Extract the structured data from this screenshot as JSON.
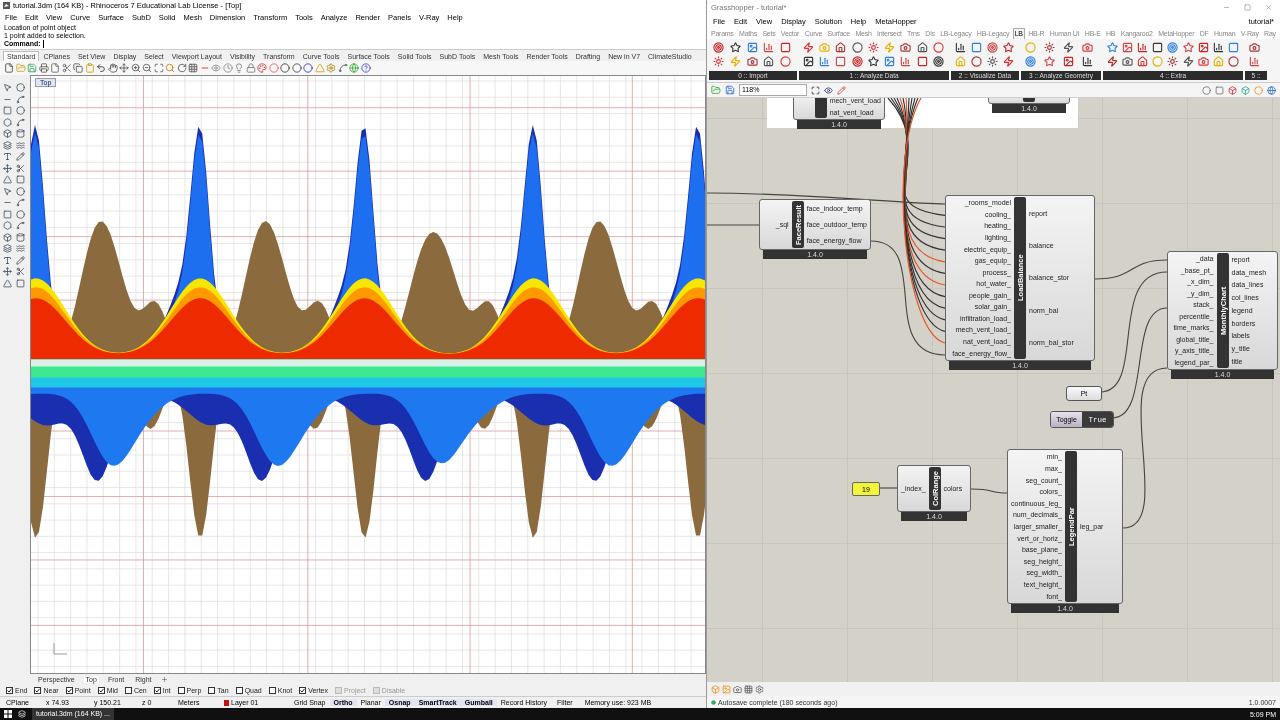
{
  "rhino": {
    "title": "tutorial.3dm (164 KB) - Rhinoceros 7 Educational Lab License - [Top]",
    "menu": [
      "File",
      "Edit",
      "View",
      "Curve",
      "Surface",
      "SubD",
      "Solid",
      "Mesh",
      "Dimension",
      "Transform",
      "Tools",
      "Analyze",
      "Render",
      "Panels",
      "V-Ray",
      "Help"
    ],
    "history": [
      "Location of point object",
      "1 point added to selection."
    ],
    "command": {
      "label": "Command:"
    },
    "toolbar_tabs": [
      {
        "label": "Standard",
        "selected": true
      },
      {
        "label": "CPlanes",
        "selected": false
      },
      {
        "label": "Set View",
        "selected": false
      },
      {
        "label": "Display",
        "selected": false
      },
      {
        "label": "Select",
        "selected": false
      },
      {
        "label": "Viewport Layout",
        "selected": false
      },
      {
        "label": "Visibility",
        "selected": false
      },
      {
        "label": "Transform",
        "selected": false
      },
      {
        "label": "Curve Tools",
        "selected": false
      },
      {
        "label": "Surface Tools",
        "selected": false
      },
      {
        "label": "Solid Tools",
        "selected": false
      },
      {
        "label": "SubD Tools",
        "selected": false
      },
      {
        "label": "Mesh Tools",
        "selected": false
      },
      {
        "label": "Render Tools",
        "selected": false
      },
      {
        "label": "Drafting",
        "selected": false
      },
      {
        "label": "New in V7",
        "selected": false
      },
      {
        "label": "ClimateStudio",
        "selected": false
      }
    ],
    "viewport": {
      "label": "Top"
    },
    "viewport_tabs": [
      {
        "label": "Perspective",
        "selected": false
      },
      {
        "label": "Top",
        "selected": true
      },
      {
        "label": "Front",
        "selected": false
      },
      {
        "label": "Right",
        "selected": false
      }
    ],
    "osnaps": [
      {
        "label": "End",
        "checked": true,
        "disabled": false
      },
      {
        "label": "Near",
        "checked": true,
        "disabled": false
      },
      {
        "label": "Point",
        "checked": true,
        "disabled": false
      },
      {
        "label": "Mid",
        "checked": true,
        "disabled": false
      },
      {
        "label": "Cen",
        "checked": false,
        "disabled": false
      },
      {
        "label": "Int",
        "checked": true,
        "disabled": false
      },
      {
        "label": "Perp",
        "checked": false,
        "disabled": false
      },
      {
        "label": "Tan",
        "checked": false,
        "disabled": false
      },
      {
        "label": "Quad",
        "checked": false,
        "disabled": false
      },
      {
        "label": "Knot",
        "checked": false,
        "disabled": false
      },
      {
        "label": "Vertex",
        "checked": true,
        "disabled": false
      },
      {
        "label": "Project",
        "checked": false,
        "disabled": true
      },
      {
        "label": "Disable",
        "checked": false,
        "disabled": true
      }
    ],
    "coords": [
      "CPlane",
      "x 74.93",
      "y 150.21",
      "z 0",
      "Meters"
    ],
    "layer": {
      "name": "Layer 01",
      "color": "#c41010"
    },
    "toggles": [
      {
        "label": "Grid Snap",
        "on": false
      },
      {
        "label": "Ortho",
        "on": true
      },
      {
        "label": "Planar",
        "on": false
      },
      {
        "label": "Osnap",
        "on": true
      },
      {
        "label": "SmartTrack",
        "on": true
      },
      {
        "label": "Gumball",
        "on": true
      },
      {
        "label": "Record History",
        "on": false
      }
    ],
    "filter": "Filter",
    "memory": "Memory use: 923 MB"
  },
  "grasshopper": {
    "title": "Grasshopper - tutorial*",
    "menu": [
      "File",
      "Edit",
      "View",
      "Display",
      "Solution",
      "Help",
      "MetaHopper"
    ],
    "document": "tutorial*",
    "tabs": [
      {
        "label": "Params",
        "selected": false
      },
      {
        "label": "Maths",
        "selected": false
      },
      {
        "label": "Sets",
        "selected": false
      },
      {
        "label": "Vector",
        "selected": false
      },
      {
        "label": "Curve",
        "selected": false
      },
      {
        "label": "Surface",
        "selected": false
      },
      {
        "label": "Mesh",
        "selected": false
      },
      {
        "label": "Intersect",
        "selected": false
      },
      {
        "label": "Trns",
        "selected": false
      },
      {
        "label": "Dis",
        "selected": false
      },
      {
        "label": "LB-Legacy",
        "selected": false
      },
      {
        "label": "HB-Legacy",
        "selected": false
      },
      {
        "label": "LB",
        "selected": true
      },
      {
        "label": "HB-R",
        "selected": false
      },
      {
        "label": "Human UI",
        "selected": false
      },
      {
        "label": "HB-E",
        "selected": false
      },
      {
        "label": "HB",
        "selected": false
      },
      {
        "label": "Kangaroo2",
        "selected": false
      },
      {
        "label": "MetaHopper",
        "selected": false
      },
      {
        "label": "DF",
        "selected": false
      },
      {
        "label": "Human",
        "selected": false
      },
      {
        "label": "V-Ray",
        "selected": false
      },
      {
        "label": "Ray",
        "selected": false
      }
    ],
    "ribbon_groups": [
      "0 :: Import",
      "1 :: Analyze Data",
      "2 :: Visualize Data",
      "3 :: Analyze Geometry",
      "4 :: Extra",
      "5 ::"
    ],
    "zoom": "118%",
    "components": [
      {
        "kind": "component",
        "outputs": [
          "mech_vent_load",
          "nat_vent_load"
        ],
        "version": "1.4.0"
      },
      {
        "kind": "component",
        "version": "1.4.0"
      },
      {
        "kind": "component",
        "name": "FaceResult",
        "inputs": [
          "_sql"
        ],
        "outputs": [
          "face_indoor_temp",
          "face_outdoor_temp",
          "face_energy_flow"
        ],
        "version": "1.4.0"
      },
      {
        "kind": "component",
        "name": "LoadBalance",
        "inputs": [
          "_rooms_model",
          "cooling_",
          "heating_",
          "lighting_",
          "electric_equip_",
          "gas_equip_",
          "process_",
          "hot_water_",
          "people_gain_",
          "solar_gain_",
          "infiltration_load_",
          "mech_vent_load_",
          "nat_vent_load_",
          "face_energy_flow_"
        ],
        "outputs": [
          "report",
          "balance",
          "balance_stor",
          "norm_bal",
          "norm_bal_stor"
        ],
        "version": "1.4.0"
      },
      {
        "kind": "component",
        "name": "MonthlyChart",
        "inputs": [
          "_data",
          "_base_pt_",
          "_x_dim_",
          "_y_dim_",
          "stack_",
          "percentile_",
          "time_marks_",
          "global_title_",
          "y_axis_title_",
          "legend_par_"
        ],
        "outputs": [
          "report",
          "data_mesh",
          "data_lines",
          "col_lines",
          "legend",
          "borders",
          "labels",
          "y_title",
          "title"
        ],
        "version": "1.4.0"
      },
      {
        "kind": "param",
        "label": "Pt"
      },
      {
        "kind": "toggle",
        "label": "Toggle",
        "value": "True"
      },
      {
        "kind": "number",
        "value": "19"
      },
      {
        "kind": "component",
        "name": "ColRange",
        "inputs": [
          "_index_"
        ],
        "outputs": [
          "colors"
        ],
        "version": "1.4.0"
      },
      {
        "kind": "component",
        "name": "LegendPar",
        "inputs": [
          "min_",
          "max_",
          "seg_count_",
          "colors_",
          "continuous_leg_",
          "num_decimals_",
          "larger_smaller_",
          "vert_or_horiz_",
          "base_plane_",
          "seg_height_",
          "seg_width_",
          "text_height_",
          "font_"
        ],
        "outputs": [
          "leg_par"
        ],
        "version": "1.4.0"
      }
    ],
    "status": "Autosave complete (180 seconds ago)",
    "build": "1.0.0007"
  },
  "taskbar": {
    "task": "tutorial.3dm (164 KB) ...",
    "time": "5:09 PM"
  }
}
